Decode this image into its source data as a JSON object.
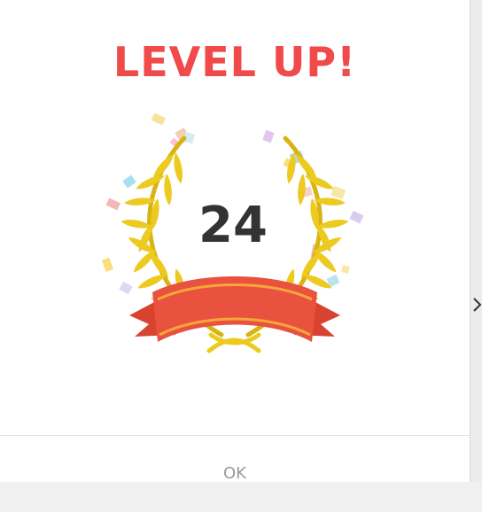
{
  "dialog": {
    "title": "LEVEL UP!",
    "level": "24",
    "ok_label": "OK"
  },
  "icons": {
    "emblem": "laurel-wreath-ribbon-icon",
    "confetti": "confetti-icon",
    "side": "chevron-right-icon"
  },
  "colors": {
    "title": "#f04a4a",
    "laurel": "#ecca1f",
    "laurel_dark": "#d8b312",
    "ribbon": "#e8523f",
    "ribbon_stripe": "#f8a53a",
    "number": "#333333",
    "ok": "#9a9a9a"
  }
}
